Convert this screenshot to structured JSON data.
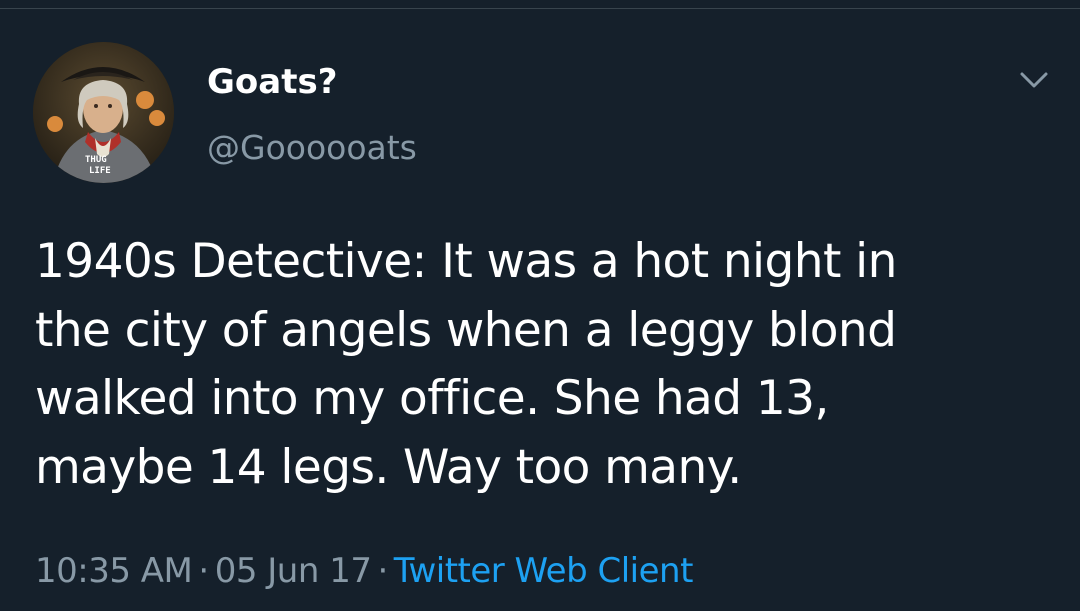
{
  "user": {
    "display_name": "Goats?",
    "handle": "@Goooooats",
    "avatar_caption_line1": "THUG",
    "avatar_caption_line2": "LIFE"
  },
  "tweet": {
    "lines": [
      "1940s Detective: It was a hot night in",
      "the city of angels when a leggy blond",
      "walked into my office. She had 13,",
      "maybe 14 legs. Way too many."
    ]
  },
  "meta": {
    "time": "10:35 AM",
    "separator": "·",
    "date": "05 Jun 17",
    "client": "Twitter Web Client"
  },
  "colors": {
    "background": "#15202b",
    "primary_text": "#ffffff",
    "secondary_text": "#8899a6",
    "link": "#1da1f2"
  },
  "icons": {
    "menu": "chevron-down-icon"
  }
}
